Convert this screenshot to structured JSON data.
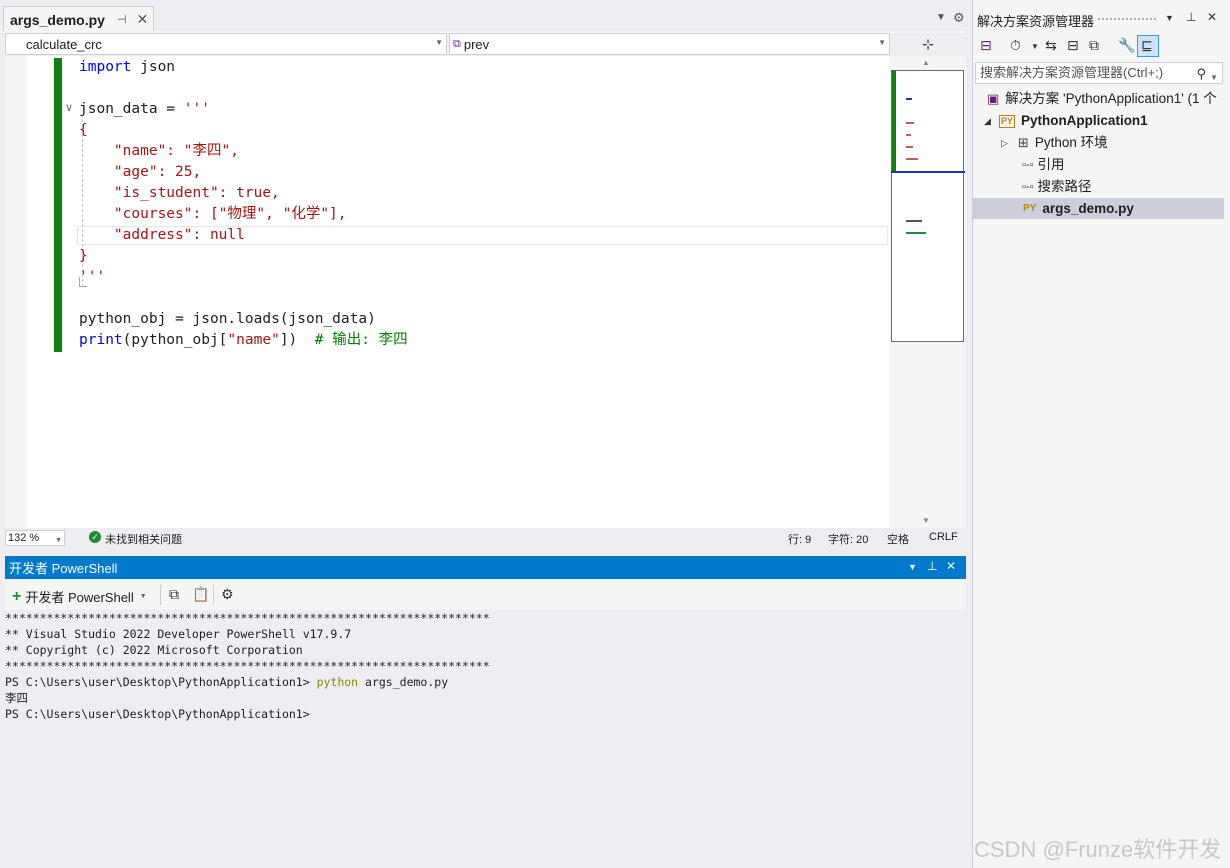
{
  "editor_tab": {
    "title": "args_demo.py",
    "pin_icon": "pin-icon",
    "close_icon": "close-icon"
  },
  "navbar": {
    "left_member": "calculate_crc",
    "right_member": "prev"
  },
  "code_lines": [
    [
      {
        "t": "import",
        "c": "kw"
      },
      {
        "t": " json",
        "c": ""
      }
    ],
    [
      {
        "t": "",
        "c": ""
      }
    ],
    [
      {
        "t": "json_data",
        "c": ""
      },
      {
        "t": " = ",
        "c": ""
      },
      {
        "t": "'''",
        "c": "str"
      }
    ],
    [
      {
        "t": "{",
        "c": "str"
      }
    ],
    [
      {
        "t": "    \"name\": \"李四\",",
        "c": "str"
      }
    ],
    [
      {
        "t": "    \"age\": 25,",
        "c": "str"
      }
    ],
    [
      {
        "t": "    \"is_student\": true,",
        "c": "str"
      }
    ],
    [
      {
        "t": "    \"courses\": [\"物理\", \"化学\"],",
        "c": "str"
      }
    ],
    [
      {
        "t": "    \"address\": null",
        "c": "str"
      }
    ],
    [
      {
        "t": "}",
        "c": "str"
      }
    ],
    [
      {
        "t": "'''",
        "c": "str"
      }
    ],
    [
      {
        "t": "",
        "c": ""
      }
    ],
    [
      {
        "t": "python_obj",
        "c": ""
      },
      {
        "t": " = json.loads(",
        "c": ""
      },
      {
        "t": "json_data",
        "c": ""
      },
      {
        "t": ")",
        "c": ""
      }
    ],
    [
      {
        "t": "print",
        "c": "kw"
      },
      {
        "t": "(python_obj[",
        "c": ""
      },
      {
        "t": "\"name\"",
        "c": "str"
      },
      {
        "t": "])  ",
        "c": ""
      },
      {
        "t": "# 输出: 李四",
        "c": "cmt"
      }
    ]
  ],
  "statusbar": {
    "zoom": "132 %",
    "issues": "未找到相关问题",
    "line": "行: 9",
    "char": "字符: 20",
    "whitespace": "空格",
    "line_ending": "CRLF"
  },
  "powershell": {
    "title": "开发者 PowerShell",
    "new_button": "开发者 PowerShell",
    "output": [
      {
        "t": "**********************************************************************",
        "cmd": ""
      },
      {
        "t": "** Visual Studio 2022 Developer PowerShell v17.9.7",
        "cmd": ""
      },
      {
        "t": "** Copyright (c) 2022 Microsoft Corporation",
        "cmd": ""
      },
      {
        "t": "**********************************************************************",
        "cmd": ""
      },
      {
        "t": "PS C:\\Users\\user\\Desktop\\PythonApplication1> ",
        "cmd": "python",
        "rest": " args_demo.py"
      },
      {
        "t": "李四",
        "cmd": ""
      },
      {
        "t": "PS C:\\Users\\user\\Desktop\\PythonApplication1>",
        "cmd": ""
      }
    ]
  },
  "solution_explorer": {
    "title": "解决方案资源管理器",
    "search_placeholder": "搜索解决方案资源管理器(Ctrl+;)",
    "tree": [
      {
        "label": "解决方案 'PythonApplication1' (1 个",
        "bold": false
      },
      {
        "label": "PythonApplication1",
        "bold": true
      },
      {
        "label": "Python 环境",
        "bold": false
      },
      {
        "label": "引用",
        "bold": false
      },
      {
        "label": "搜索路径",
        "bold": false
      },
      {
        "label": "args_demo.py",
        "bold": true
      }
    ]
  },
  "watermark": "CSDN @Frunze软件开发",
  "colors": {
    "accent": "#007acc",
    "change_bar": "#108010",
    "keyword": "#0000ff",
    "string": "#a31515",
    "comment": "#008000"
  }
}
